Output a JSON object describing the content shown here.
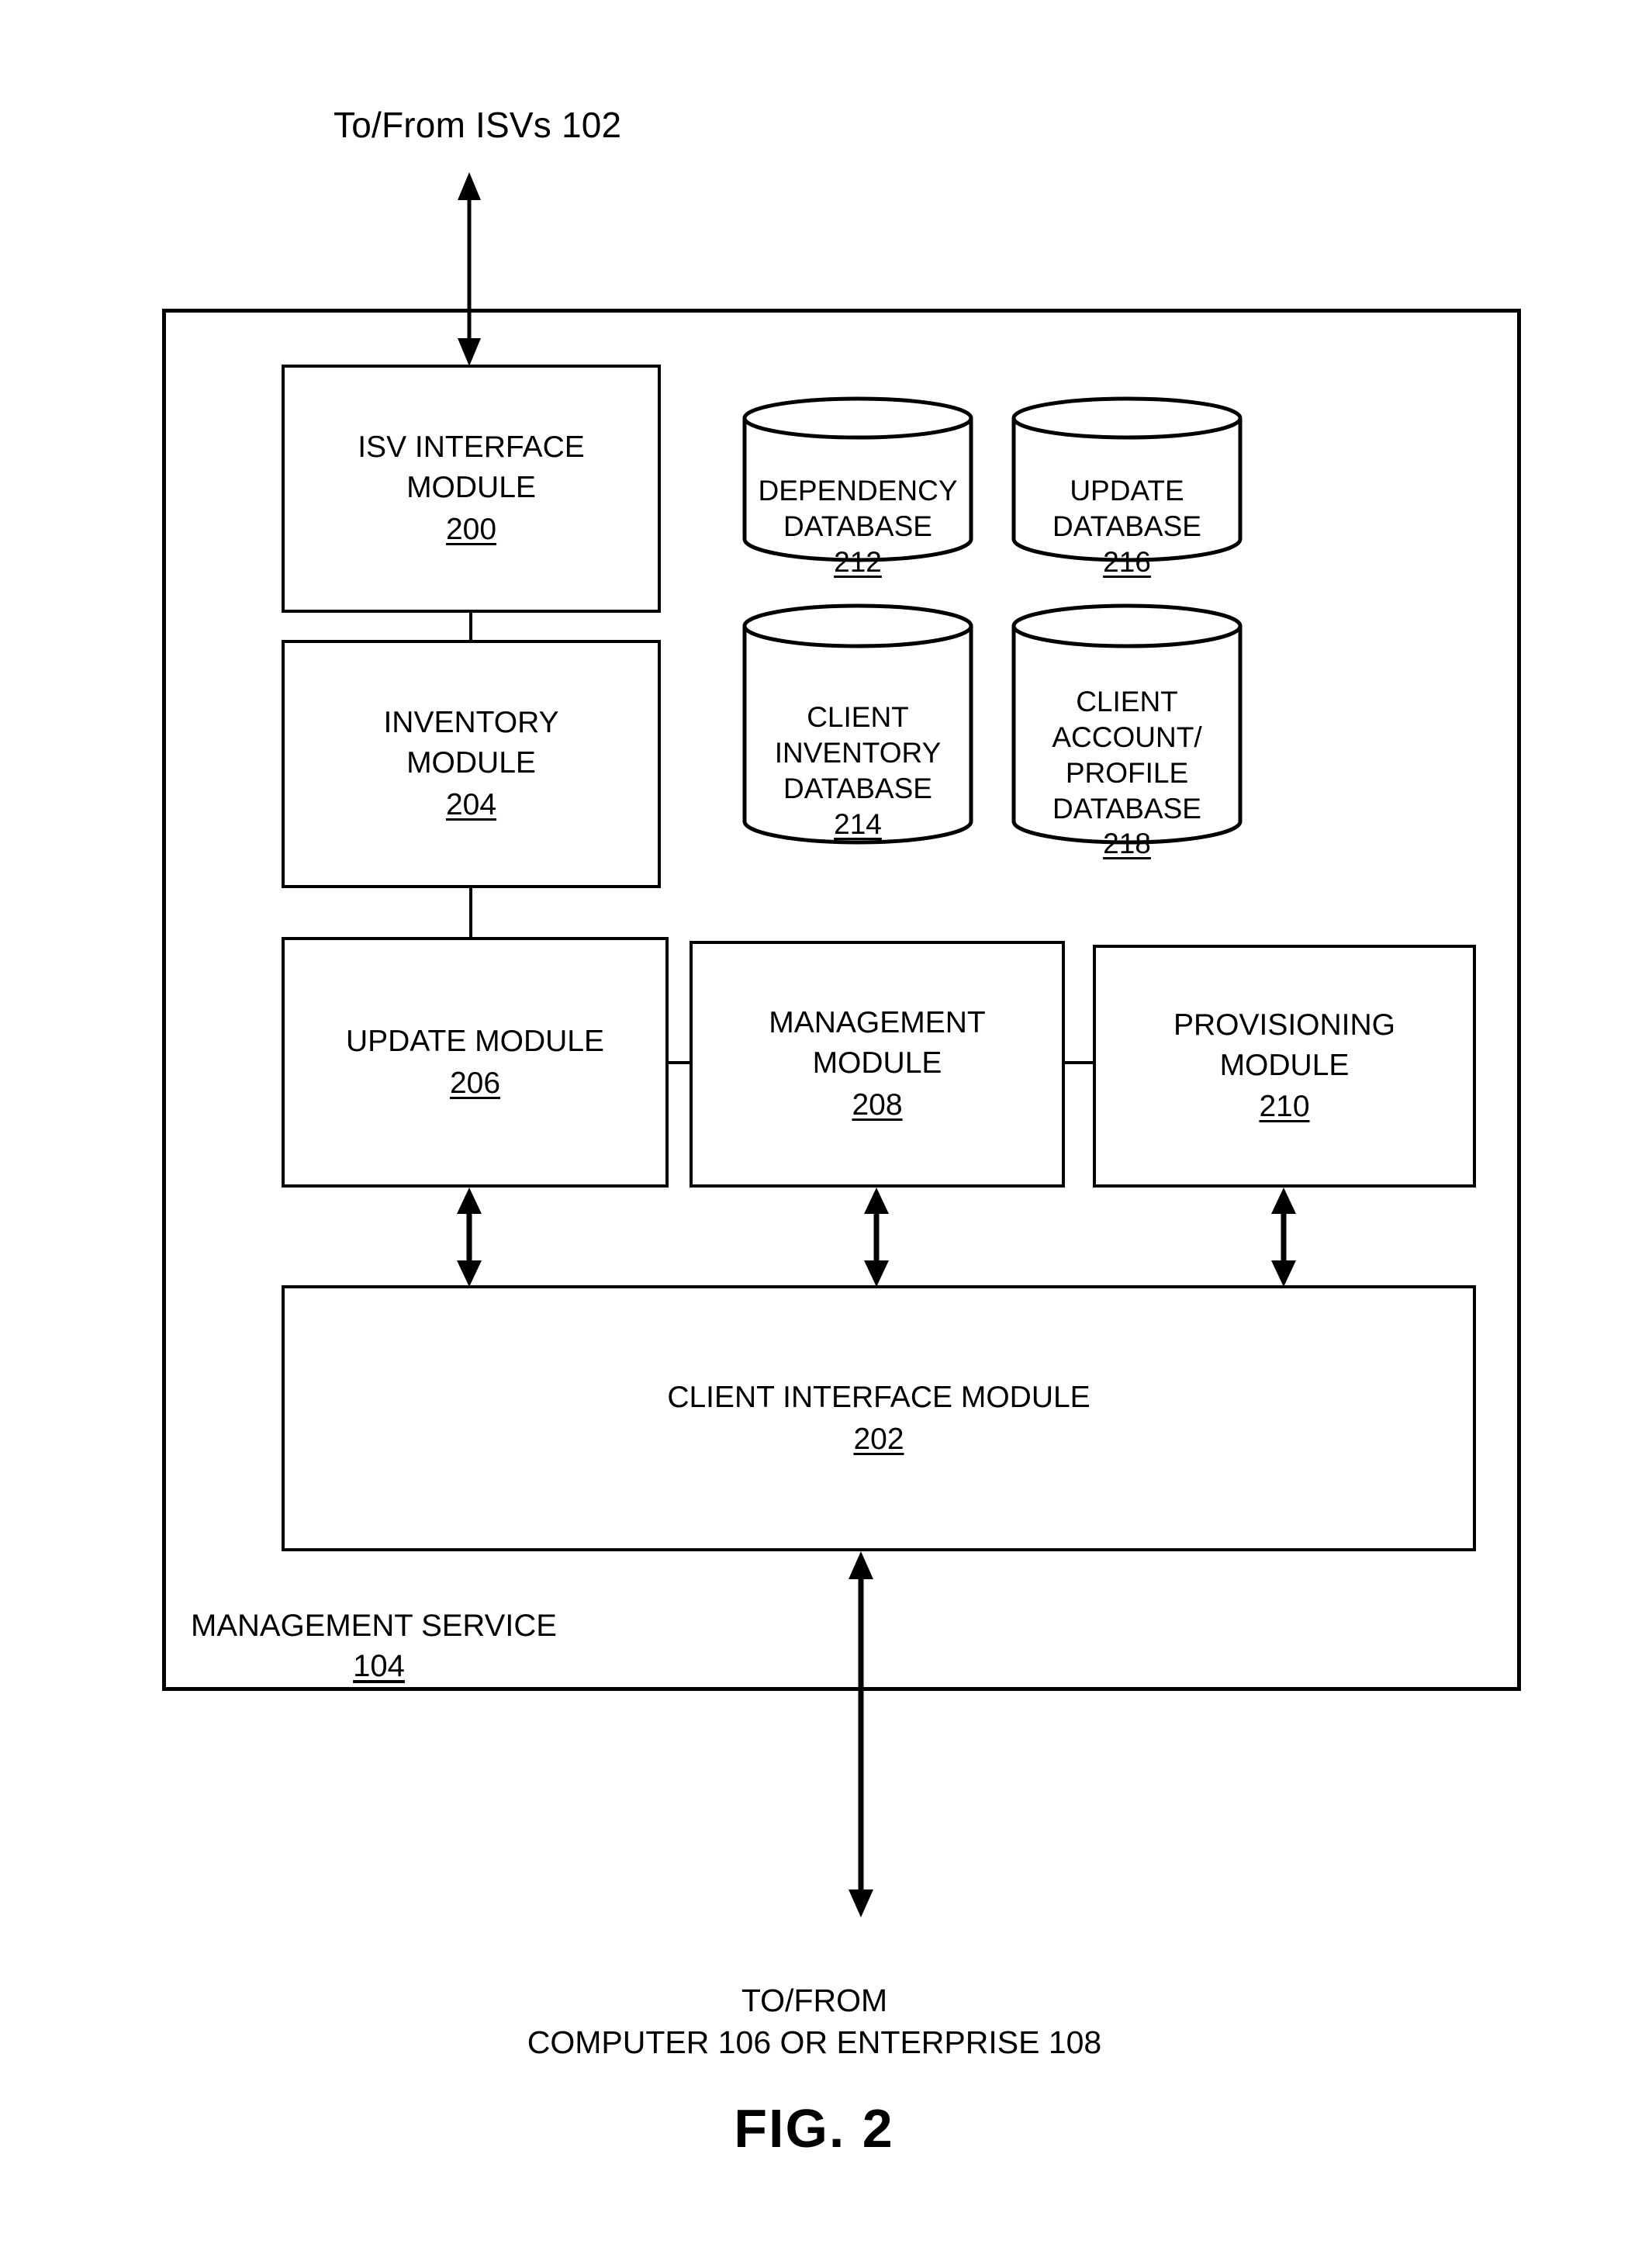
{
  "figure": {
    "caption": "FIG. 2",
    "top_label": "To/From ISVs 102",
    "bottom_label_line1": "TO/FROM",
    "bottom_label_line2": "COMPUTER 106 OR ENTERPRISE 108"
  },
  "service": {
    "name": "MANAGEMENT SERVICE",
    "ref": "104"
  },
  "modules": [
    {
      "id": "isv-interface",
      "title": "ISV INTERFACE\nMODULE",
      "ref": "200"
    },
    {
      "id": "client-interface",
      "title": "CLIENT INTERFACE MODULE",
      "ref": "202"
    },
    {
      "id": "inventory",
      "title": "INVENTORY\nMODULE",
      "ref": "204"
    },
    {
      "id": "update",
      "title": "UPDATE MODULE",
      "ref": "206"
    },
    {
      "id": "management",
      "title": "MANAGEMENT\nMODULE",
      "ref": "208"
    },
    {
      "id": "provisioning",
      "title": "PROVISIONING\nMODULE",
      "ref": "210"
    }
  ],
  "databases": [
    {
      "id": "dependency",
      "title": "DEPENDENCY\nDATABASE",
      "ref": "212"
    },
    {
      "id": "client-inventory",
      "title": "CLIENT\nINVENTORY\nDATABASE",
      "ref": "214"
    },
    {
      "id": "update",
      "title": "UPDATE\nDATABASE",
      "ref": "216"
    },
    {
      "id": "client-account",
      "title": "CLIENT\nACCOUNT/\nPROFILE\nDATABASE",
      "ref": "218"
    }
  ],
  "colors": {
    "stroke": "#000000",
    "background": "#ffffff"
  }
}
